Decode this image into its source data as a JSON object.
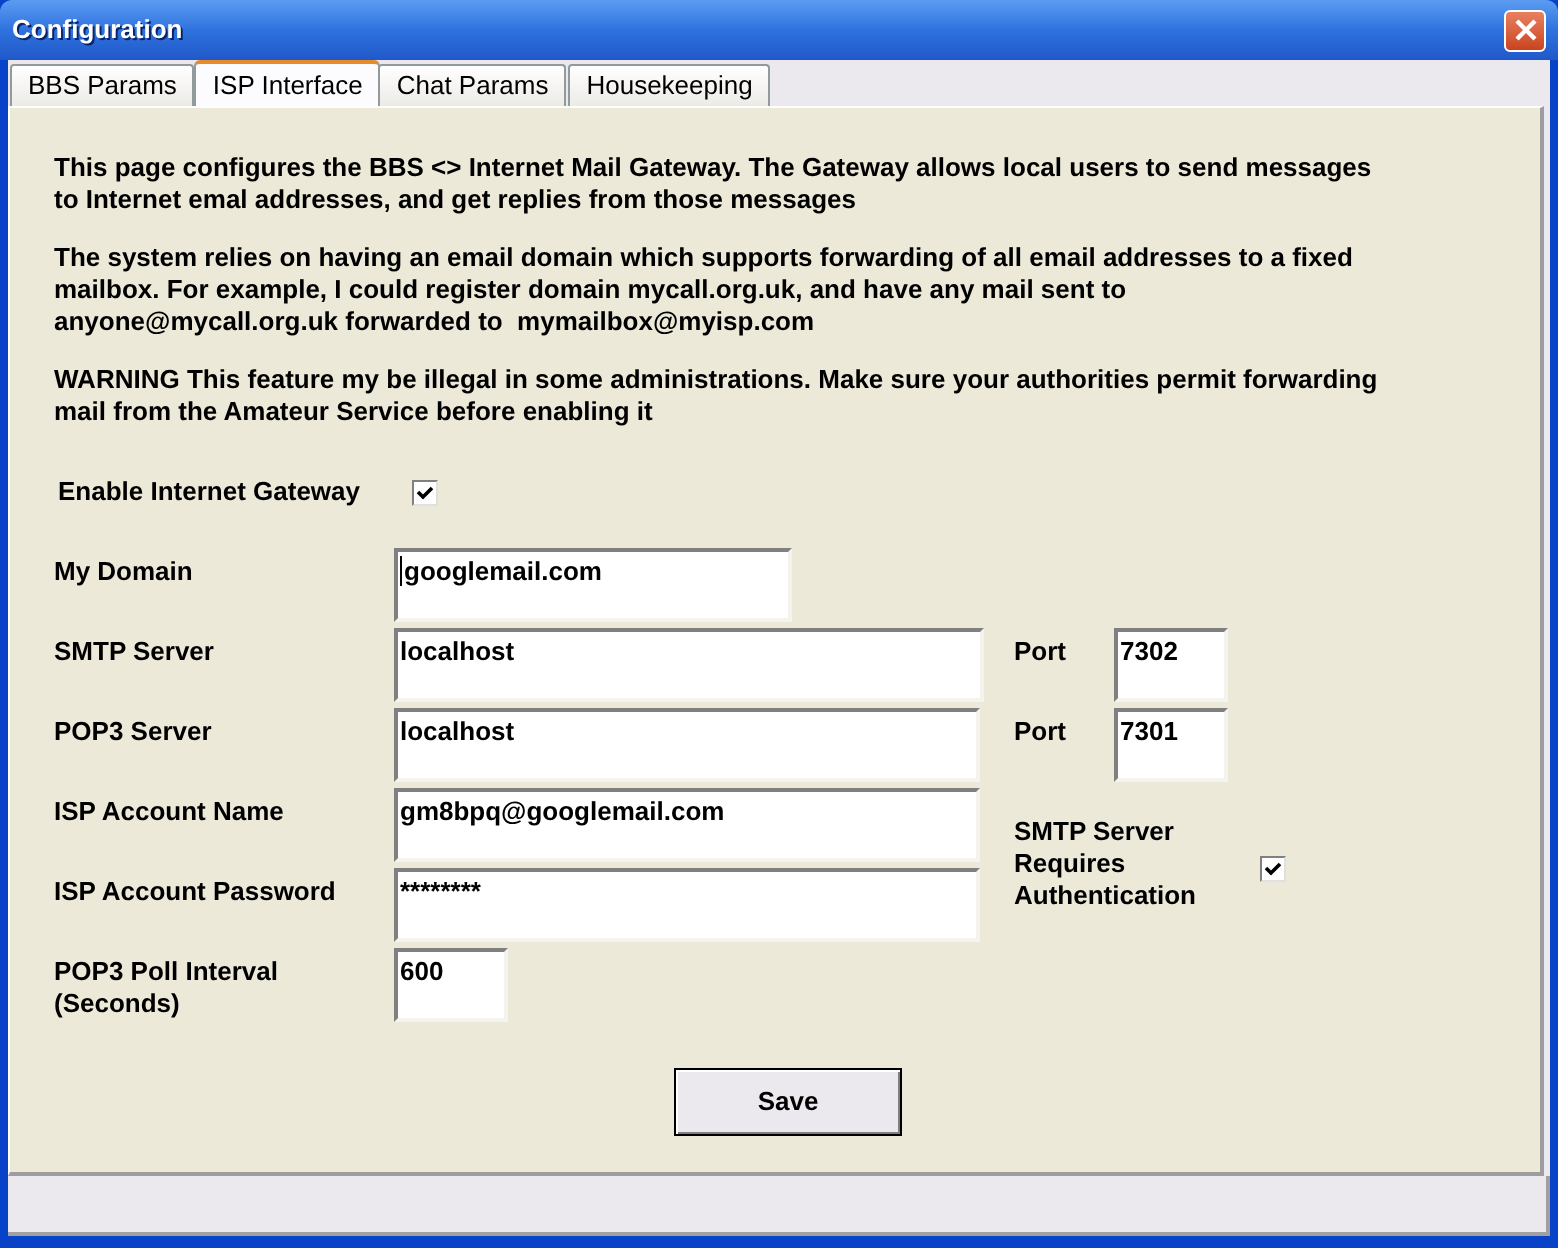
{
  "window": {
    "title": "Configuration"
  },
  "tabs": [
    {
      "label": "BBS Params",
      "selected": false
    },
    {
      "label": "ISP Interface",
      "selected": true
    },
    {
      "label": "Chat Params",
      "selected": false
    },
    {
      "label": "Housekeeping",
      "selected": false
    }
  ],
  "description": [
    "This page configures the BBS <> Internet Mail Gateway. The Gateway allows local users to send messages\nto Internet emal addresses, and get replies from those messages",
    "The system relies on having an email domain which supports forwarding of all email addresses to a fixed\nmailbox. For example, I could register domain mycall.org.uk, and have any mail sent to\nanyone@mycall.org.uk forwarded to  mymailbox@myisp.com",
    "WARNING This feature my be illegal in some administrations. Make sure your authorities permit forwarding\nmail from the Amateur Service before enabling it"
  ],
  "gateway": {
    "label": "Enable Internet Gateway",
    "checked": true
  },
  "fields": [
    {
      "label": "My Domain",
      "value": "googlemail.com",
      "focused": true
    },
    {
      "label": "SMTP Server",
      "value": "localhost",
      "focused": false,
      "port": {
        "label": "Port",
        "value": "7302"
      }
    },
    {
      "label": "POP3 Server",
      "value": "localhost",
      "focused": false,
      "port": {
        "label": "Port",
        "value": "7301"
      }
    },
    {
      "label": "ISP Account Name",
      "value": "gm8bpq@googlemail.com",
      "focused": false
    },
    {
      "label": "ISP Account Password",
      "value": "********",
      "focused": false
    },
    {
      "label": "POP3 Poll Interval\n(Seconds)",
      "value": "600",
      "focused": false
    }
  ],
  "authentication": {
    "label": "SMTP Server\nRequires\nAuthentication",
    "checked": true
  },
  "buttons": [
    {
      "label": "Save"
    }
  ]
}
